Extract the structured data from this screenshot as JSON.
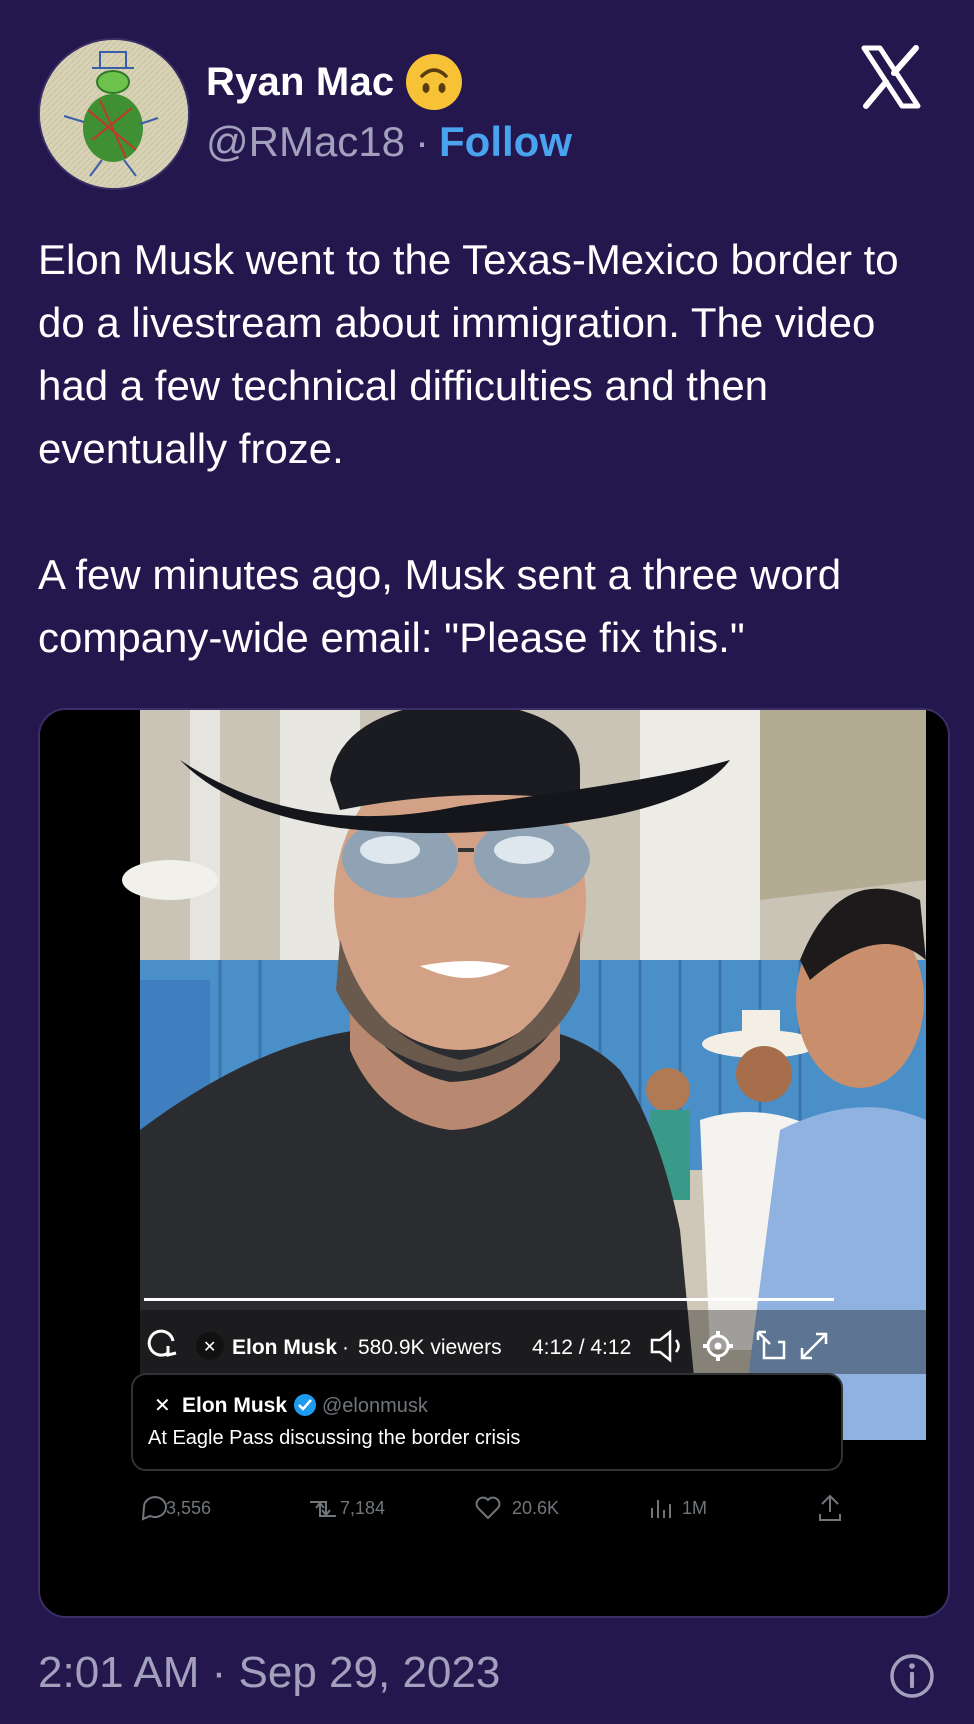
{
  "author": {
    "name": "Ryan Mac",
    "name_emoji": "upside-down-face-emoji",
    "handle": "@RMac18",
    "separator": "·",
    "follow_label": "Follow"
  },
  "tweet": {
    "paragraph_1": "Elon Musk went to the Texas-Mexico border to do a livestream about immigration. The video had a few technical difficulties and then eventually froze.",
    "paragraph_2": "A few minutes ago, Musk sent a three word company-wide email: \"Please fix this.\""
  },
  "embedded": {
    "player": {
      "streamer": "Elon Musk",
      "separator": "·",
      "viewers": "580.9K viewers",
      "time": "4:12 / 4:12",
      "progress_percent": 100
    },
    "quoted_post": {
      "name": "Elon Musk",
      "handle": "@elonmusk",
      "text": "At Eagle Pass discussing the border crisis"
    },
    "stats": {
      "replies": "3,556",
      "reposts": "7,184",
      "likes": "20.6K",
      "views": "1M"
    }
  },
  "footer": {
    "timestamp": "2:01 AM · Sep 29, 2023"
  },
  "icons": [
    "x-logo-icon",
    "info-icon",
    "reload-icon",
    "volume-icon",
    "gear-icon",
    "pip-icon",
    "expand-icon",
    "reply-icon",
    "repost-icon",
    "like-icon",
    "views-icon",
    "share-icon",
    "verified-badge-icon"
  ],
  "colors": {
    "background": "#23174e",
    "follow": "#4aa3ef",
    "muted": "#a3a0bd",
    "verified": "#1d9bf0"
  }
}
